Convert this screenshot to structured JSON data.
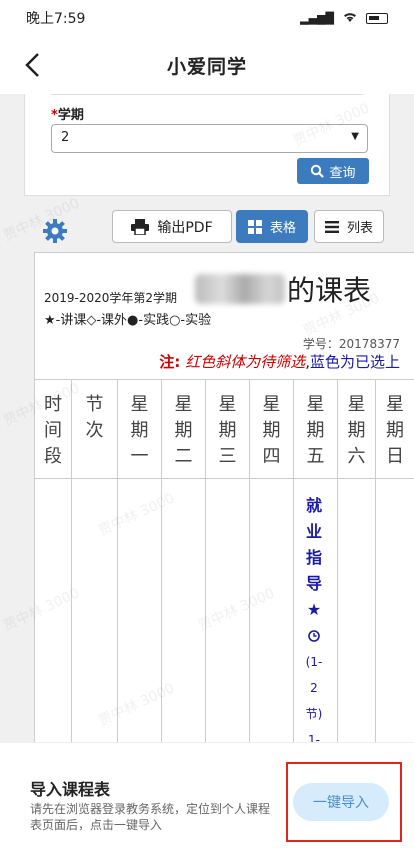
{
  "status": {
    "time": "晚上7:59",
    "signal": "HD"
  },
  "appbar": {
    "title": "小爱同学"
  },
  "form": {
    "term_label": "学期",
    "term_value": "2",
    "query_label": "查询"
  },
  "toolbar": {
    "pdf_label": "输出PDF",
    "table_label": "表格",
    "list_label": "列表"
  },
  "schedule": {
    "term": "2019-2020学年第2学期",
    "legend": "★-讲课◇-课外●-实践○-实验",
    "title_suffix": "的课表",
    "student_id": "学号：20178377",
    "note_label": "注:",
    "note_red": "红色斜体为待筛选",
    "note_sep": ",",
    "note_blue": "蓝色为已选上",
    "headers": [
      "时间段",
      "节次",
      "星期一",
      "星期二",
      "星期三",
      "星期四",
      "星期五",
      "星期六",
      "星期日"
    ],
    "course": {
      "chars": [
        "就",
        "业",
        "指",
        "导",
        "★"
      ],
      "detail": [
        "(1-",
        "2",
        "节)",
        "1-"
      ]
    }
  },
  "watermark": "贾中林 3000",
  "import": {
    "title": "导入课程表",
    "desc": "请先在浏览器登录教务系统，定位到个人课程表页面后，点击一键导入",
    "button": "一键导入"
  }
}
